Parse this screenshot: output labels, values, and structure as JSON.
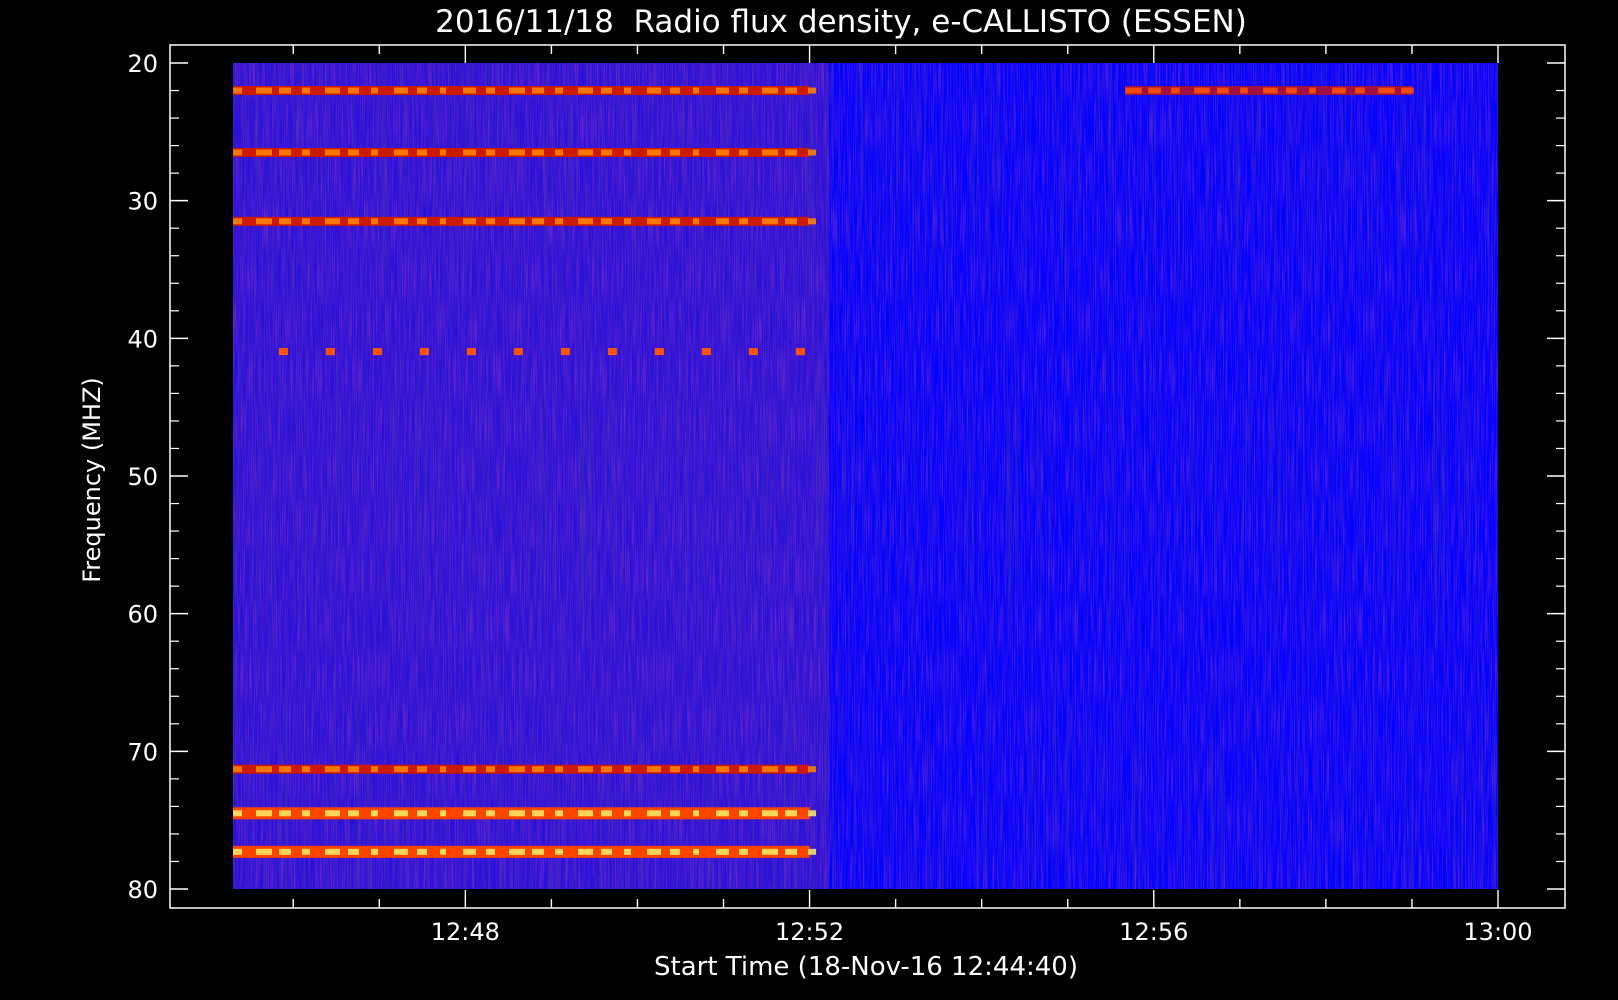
{
  "chart_data": {
    "type": "heatmap",
    "title": "2016/11/18  Radio flux density, e-CALLISTO (ESSEN)",
    "xlabel": "Start Time (18-Nov-16 12:44:40)",
    "ylabel": "Frequency (MHZ)",
    "x_range": [
      "12:45:18",
      "13:00:00"
    ],
    "y_range_mhz": [
      20,
      80
    ],
    "y_axis_inverted": true,
    "x_ticks": [
      "12:48",
      "12:52",
      "12:56",
      "13:00"
    ],
    "y_ticks": [
      20,
      30,
      40,
      50,
      60,
      70,
      80
    ],
    "colormap": [
      "#000000",
      "#1a1a8c",
      "#0000ff",
      "#7a1a9a",
      "#cc0000",
      "#ff6600",
      "#ffff66"
    ],
    "background_color": "#0000ff",
    "features": [
      {
        "kind": "narrowband_emission",
        "freq_mhz": 22,
        "time_start": "12:45:18",
        "time_end": "12:52:00",
        "intensity": "high"
      },
      {
        "kind": "narrowband_emission",
        "freq_mhz": 22,
        "time_start": "12:55:40",
        "time_end": "12:59:00",
        "intensity": "medium"
      },
      {
        "kind": "narrowband_emission",
        "freq_mhz": 26.5,
        "time_start": "12:45:18",
        "time_end": "12:52:00",
        "intensity": "high"
      },
      {
        "kind": "narrowband_emission",
        "freq_mhz": 31.5,
        "time_start": "12:45:18",
        "time_end": "12:52:00",
        "intensity": "high"
      },
      {
        "kind": "periodic_spikes",
        "freq_mhz": 41,
        "time_start": "12:45:50",
        "time_end": "12:52:20",
        "intensity": "medium"
      },
      {
        "kind": "narrowband_emission",
        "freq_mhz": 71.3,
        "time_start": "12:45:18",
        "time_end": "12:52:00",
        "intensity": "high"
      },
      {
        "kind": "narrowband_emission",
        "freq_mhz": 74.5,
        "time_start": "12:45:18",
        "time_end": "12:52:00",
        "intensity": "very high"
      },
      {
        "kind": "narrowband_emission",
        "freq_mhz": 77.3,
        "time_start": "12:45:18",
        "time_end": "12:52:00",
        "intensity": "very high"
      }
    ]
  }
}
